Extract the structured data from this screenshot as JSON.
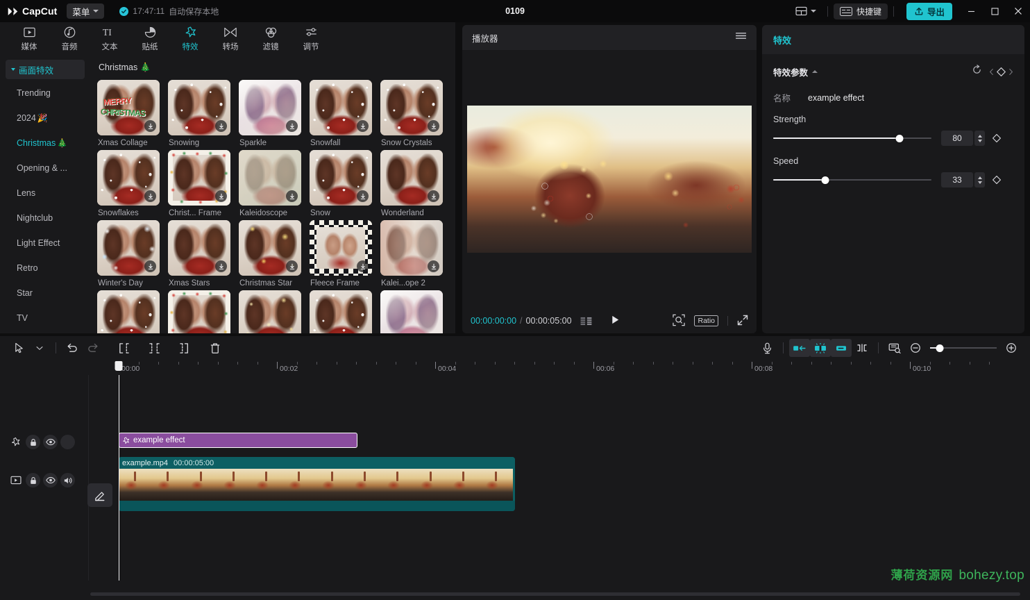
{
  "titlebar": {
    "brand": "CapCut",
    "menu_label": "菜单",
    "save_time": "17:47:11",
    "save_text": "自动保存本地",
    "project_title": "0109",
    "shortcut_label": "快捷键",
    "export_label": "导出",
    "layout_icon": "layout-icon",
    "minimize_icon": "minimize-icon",
    "maximize_icon": "maximize-icon",
    "close_icon": "close-icon"
  },
  "tabs": [
    {
      "label": "媒体",
      "icon": "media-icon",
      "active": false
    },
    {
      "label": "音频",
      "icon": "audio-icon",
      "active": false
    },
    {
      "label": "文本",
      "icon": "text-icon",
      "active": false
    },
    {
      "label": "贴纸",
      "icon": "sticker-icon",
      "active": false
    },
    {
      "label": "特效",
      "icon": "effects-icon",
      "active": true
    },
    {
      "label": "转场",
      "icon": "transition-icon",
      "active": false
    },
    {
      "label": "滤镜",
      "icon": "filter-icon",
      "active": false
    },
    {
      "label": "调节",
      "icon": "adjust-icon",
      "active": false
    }
  ],
  "categories": {
    "header": "画面特效",
    "items": [
      {
        "label": "Trending",
        "selected": false
      },
      {
        "label": "2024",
        "emoji": "🎉",
        "selected": false
      },
      {
        "label": "Christmas",
        "emoji": "🎄",
        "selected": true
      },
      {
        "label": "Opening & ...",
        "selected": false
      },
      {
        "label": "Lens",
        "selected": false
      },
      {
        "label": "Nightclub",
        "selected": false
      },
      {
        "label": "Light Effect",
        "selected": false
      },
      {
        "label": "Retro",
        "selected": false
      },
      {
        "label": "Star",
        "selected": false
      },
      {
        "label": "TV",
        "selected": false
      }
    ]
  },
  "effects_grid": {
    "title": "Christmas 🎄",
    "items": [
      {
        "label": "Xmas Collage",
        "style": "collage",
        "word1": "MERRY",
        "word2": "CHRISTMAS"
      },
      {
        "label": "Snowing",
        "style": "snow"
      },
      {
        "label": "Sparkle",
        "style": "purple"
      },
      {
        "label": "Snowfall",
        "style": "snow"
      },
      {
        "label": "Snow Crystals",
        "style": "snow"
      },
      {
        "label": "Snowflakes",
        "style": "snow"
      },
      {
        "label": "Christ... Frame",
        "style": "frame"
      },
      {
        "label": "Kaleidoscope",
        "style": "blur"
      },
      {
        "label": "Snow",
        "style": "snow"
      },
      {
        "label": "Wonderland",
        "style": "plain"
      },
      {
        "label": "Winter's Day",
        "style": "winter"
      },
      {
        "label": "Xmas Stars",
        "style": "plain"
      },
      {
        "label": "Christmas Star",
        "style": "star"
      },
      {
        "label": "Fleece Frame",
        "style": "checker"
      },
      {
        "label": "Kalei...ope 2",
        "style": "kalei2"
      }
    ]
  },
  "player": {
    "title": "播放器",
    "current_time": "00:00:00:00",
    "time_separator": "/",
    "total_time": "00:00:05:00",
    "ratio_label": "Ratio",
    "menu_icon": "hamburger-icon",
    "frames_icon": "frames-icon",
    "play_icon": "play-icon",
    "zoom_icon": "magnifier-icon",
    "fullscreen_icon": "fullscreen-icon"
  },
  "properties": {
    "title": "特效",
    "section_title": "特效参数",
    "reset_icon": "reset-icon",
    "keyframe_icon": "keyframe-diamond-icon",
    "name_label": "名称",
    "name_value": "example effect",
    "params": [
      {
        "label": "Strength",
        "value": "80",
        "percent": 80
      },
      {
        "label": "Speed",
        "value": "33",
        "percent": 33
      }
    ]
  },
  "timeline": {
    "toolbar_left": [
      {
        "name": "select-tool-icon",
        "enabled": true
      },
      {
        "name": "tool-dropdown-icon",
        "enabled": true
      },
      {
        "name": "undo-icon",
        "enabled": true
      },
      {
        "name": "redo-icon",
        "enabled": false
      },
      {
        "name": "split-left-icon",
        "enabled": true
      },
      {
        "name": "split-icon",
        "enabled": true
      },
      {
        "name": "split-right-icon",
        "enabled": true
      },
      {
        "name": "delete-icon",
        "enabled": true
      }
    ],
    "toolbar_right": [
      {
        "name": "microphone-icon",
        "active": false
      },
      {
        "name": "mirror-left-icon",
        "active": false
      },
      {
        "name": "auto-fit-icon",
        "active": true
      },
      {
        "name": "mirror-right-icon",
        "active": false
      },
      {
        "name": "cut-marker-icon",
        "active": false
      },
      {
        "name": "snapshot-icon",
        "active": false
      },
      {
        "name": "zoom-out-icon",
        "active": false
      },
      {
        "name": "zoom-in-icon",
        "active": false
      }
    ],
    "ruler_labels": [
      "00:00",
      "00:02",
      "00:04",
      "00:06",
      "00:08",
      "00:10"
    ],
    "playhead_time": "00:00",
    "effect_track": {
      "clip_label": "example effect",
      "icon": "effect-star-icon",
      "head_icons": [
        "effect-star-icon",
        "lock-icon",
        "eye-icon",
        "blank-icon"
      ]
    },
    "video_track": {
      "clip_name": "example.mp4",
      "clip_duration": "00:00:05:00",
      "head_icons": [
        "video-icon",
        "lock-icon",
        "eye-icon",
        "volume-icon"
      ]
    },
    "edit_pencil_icon": "pencil-icon"
  },
  "watermark": {
    "cn": "薄荷资源网",
    "en": "bohezy.top"
  },
  "colors": {
    "accent": "#20c4cf",
    "effect_clip": "#8a4d9e",
    "video_clip": "#0d5f63",
    "panel_bg": "#19191b",
    "app_bg": "#0e0e0f",
    "watermark_green": "#2fa24a"
  }
}
